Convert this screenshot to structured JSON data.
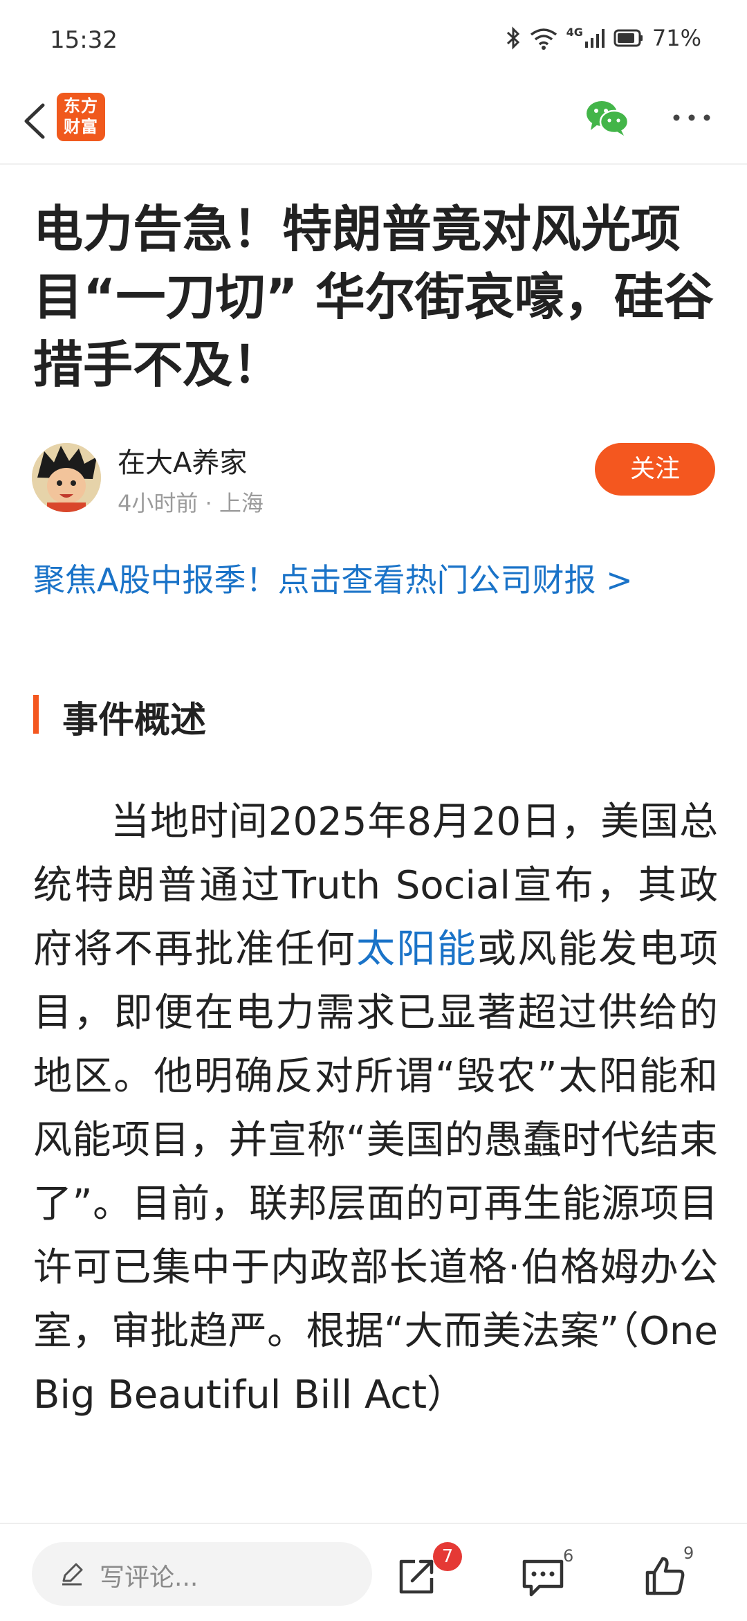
{
  "status_bar": {
    "time": "15:32",
    "network_label": "4G",
    "battery": "71%"
  },
  "app_bar": {
    "logo_line1": "东方",
    "logo_line2": "财富"
  },
  "article": {
    "title": "电力告急！特朗普竟对风光项目“一刀切” 华尔街哀嚎，硅谷措手不及！",
    "author": "在大A养家",
    "meta": "4小时前 · 上海",
    "follow_label": "关注",
    "promo": "聚焦A股中报季！点击查看热门公司财报 >",
    "section_heading": "事件概述",
    "body_part1": "当地时间2025年8月20日，美国总统特朗普通过Truth Social宣布，其政府将不再批准任何",
    "body_link": "太阳能",
    "body_part2": "或风能发电项目，即便在电力需求已显著超过供给的地区。他明确反对所谓“毁农”太阳能和风能项目，并宣称“美国的愚蠢时代结束了”。目前，联邦层面的可再生能源项目许可已集中于内政部长道格·伯格姆办公室，审批趋严。根据“大而美法案”（One Big Beautiful Bill Act）"
  },
  "bottom_bar": {
    "comment_placeholder": "写评论...",
    "share_badge": "7",
    "comment_count": "6",
    "like_count": "9"
  },
  "colors": {
    "accent": "#f4571f",
    "link": "#1a73c8",
    "badge": "#e53935"
  }
}
